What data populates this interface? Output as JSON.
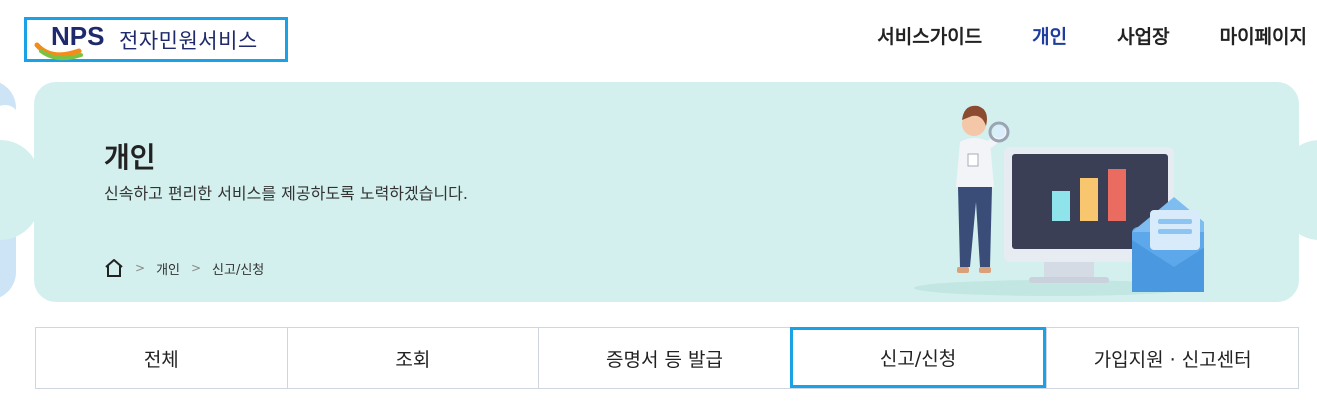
{
  "header": {
    "logo_text": "NPS",
    "logo_service": "전자민원서비스",
    "nav": [
      {
        "label": "서비스가이드",
        "active": false
      },
      {
        "label": "개인",
        "active": true
      },
      {
        "label": "사업장",
        "active": false
      },
      {
        "label": "마이페이지",
        "active": false
      }
    ]
  },
  "banner": {
    "title": "개인",
    "subtitle": "신속하고 편리한 서비스를 제공하도록 노력하겠습니다.",
    "breadcrumb": [
      "개인",
      "신고/신청"
    ],
    "background_color": "#d3f0ee"
  },
  "tabs": [
    {
      "label": "전체",
      "active": false
    },
    {
      "label": "조회",
      "active": false
    },
    {
      "label": "증명서 등 발급",
      "active": false
    },
    {
      "label": "신고/신청",
      "active": true
    },
    {
      "label": "가입지원 · 신고센터",
      "active": false
    }
  ],
  "colors": {
    "accent_border": "#1aa1e6",
    "nav_active": "#1e3d9e",
    "logo_navy": "#1e2a6b"
  }
}
